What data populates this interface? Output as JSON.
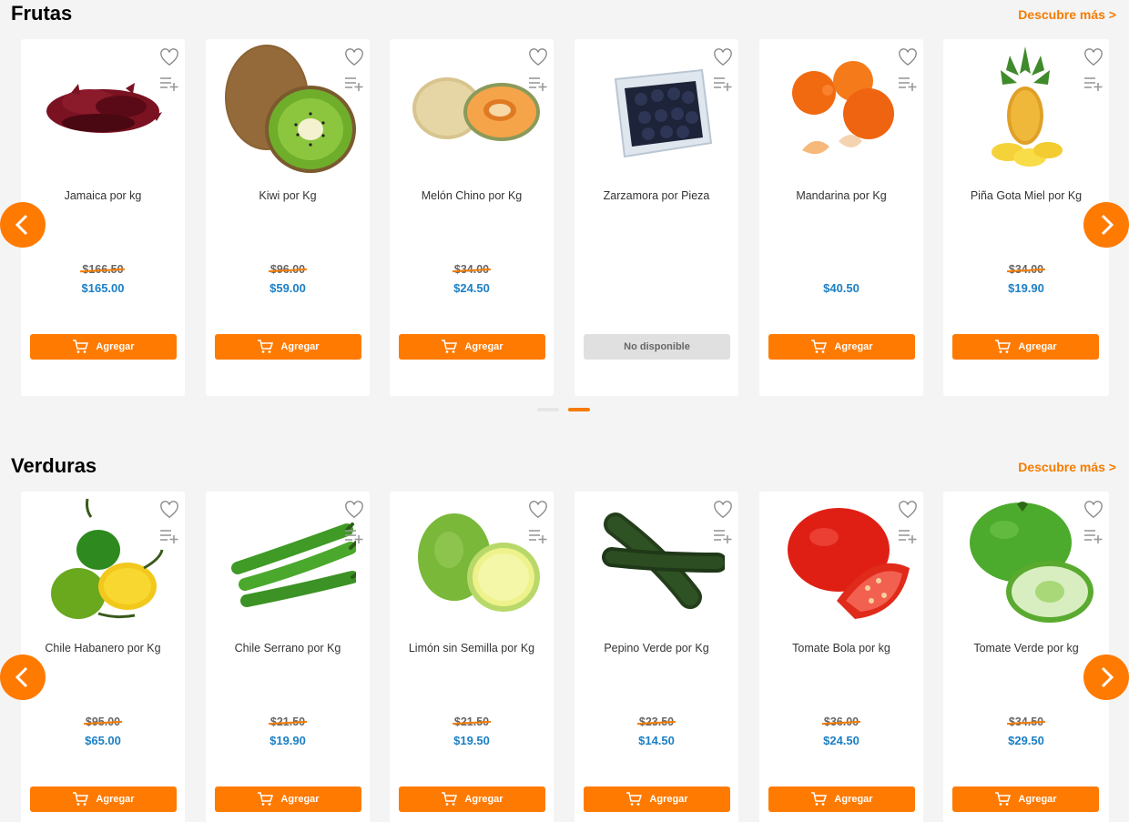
{
  "sections": [
    {
      "title": "Frutas",
      "discover_label": "Descubre más >",
      "products": [
        {
          "name": "Jamaica por kg",
          "old_price": "$166.50",
          "price": "$165.00",
          "button": "Agregar",
          "image": "jamaica"
        },
        {
          "name": "Kiwi por Kg",
          "old_price": "$96.00",
          "price": "$59.00",
          "button": "Agregar",
          "image": "kiwi"
        },
        {
          "name": "Melón Chino por Kg",
          "old_price": "$34.00",
          "price": "$24.50",
          "button": "Agregar",
          "image": "melon"
        },
        {
          "name": "Zarzamora por Pieza",
          "old_price": "",
          "price": "",
          "button": "No disponible",
          "image": "zarzamora"
        },
        {
          "name": "Mandarina por Kg",
          "old_price": "",
          "price": "$40.50",
          "button": "Agregar",
          "image": "mandarina"
        },
        {
          "name": "Piña Gota Miel por Kg",
          "old_price": "$34.00",
          "price": "$19.90",
          "button": "Agregar",
          "image": "pina"
        }
      ]
    },
    {
      "title": "Verduras",
      "discover_label": "Descubre más >",
      "products": [
        {
          "name": "Chile Habanero por Kg",
          "old_price": "$95.00",
          "price": "$65.00",
          "button": "Agregar",
          "image": "habanero"
        },
        {
          "name": "Chile Serrano por Kg",
          "old_price": "$21.50",
          "price": "$19.90",
          "button": "Agregar",
          "image": "serrano"
        },
        {
          "name": "Limón sin Semilla por Kg",
          "old_price": "$21.50",
          "price": "$19.50",
          "button": "Agregar",
          "image": "limon"
        },
        {
          "name": "Pepino Verde por Kg",
          "old_price": "$23.50",
          "price": "$14.50",
          "button": "Agregar",
          "image": "pepino"
        },
        {
          "name": "Tomate Bola por kg",
          "old_price": "$36.00",
          "price": "$24.50",
          "button": "Agregar",
          "image": "tomate"
        },
        {
          "name": "Tomate Verde por kg",
          "old_price": "$34.50",
          "price": "$29.50",
          "button": "Agregar",
          "image": "tomate-verde"
        }
      ]
    }
  ],
  "carousel": {
    "page_count": 2,
    "active_page": 2
  },
  "colors": {
    "accent": "#ff7a00",
    "price": "#1b7fc4",
    "disabled": "#e0e0e0"
  },
  "icons": [
    "heart-icon",
    "add-to-list-icon",
    "cart-icon",
    "chevron-left-icon",
    "chevron-right-icon"
  ]
}
